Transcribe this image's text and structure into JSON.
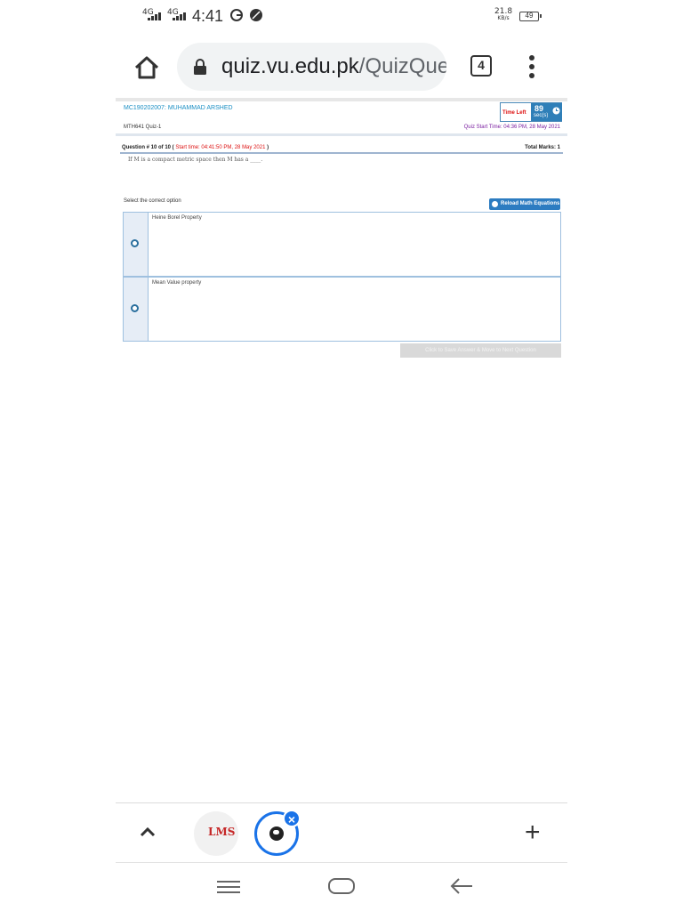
{
  "status_bar": {
    "signal1": "4G",
    "signal2": "4G",
    "time": "4:41",
    "net_speed_value": "21.8",
    "net_speed_unit": "KB/s",
    "battery": "49"
  },
  "browser": {
    "url_host": "quiz.vu.edu.pk",
    "url_path": "/QuizQues",
    "tab_count": "4"
  },
  "quiz": {
    "student": "MC190202007: MUHAMMAD ARSHED",
    "time_left_label": "Time Left",
    "time_left_value": "89",
    "time_left_unit": "sec(s)",
    "course": "MTH641 Quiz-1",
    "quiz_start": "Quiz Start Time: 04:36 PM, 28 May 2021",
    "question_number": "Question # 10 of 10 (",
    "question_start": "Start time: 04:41:50 PM, 28 May 2021",
    "question_close": ")",
    "total_marks": "Total Marks: 1",
    "question_text": "If M is a compact metric space then M has a ____.",
    "select_label": "Select the correct option",
    "reload_button": "Reload Math Equations",
    "options": [
      "Heine Borel Property",
      "Mean Value property"
    ],
    "save_button": "Click to Save Answer & Move to Next Question"
  },
  "tab_strip": {
    "tab1_logo": "LMS",
    "close_symbol": "×",
    "new_tab_symbol": "+"
  },
  "icons": {
    "accent": "#1a73e8",
    "timer_bg": "#2f7fb8",
    "link_color": "#1b8fc4"
  }
}
